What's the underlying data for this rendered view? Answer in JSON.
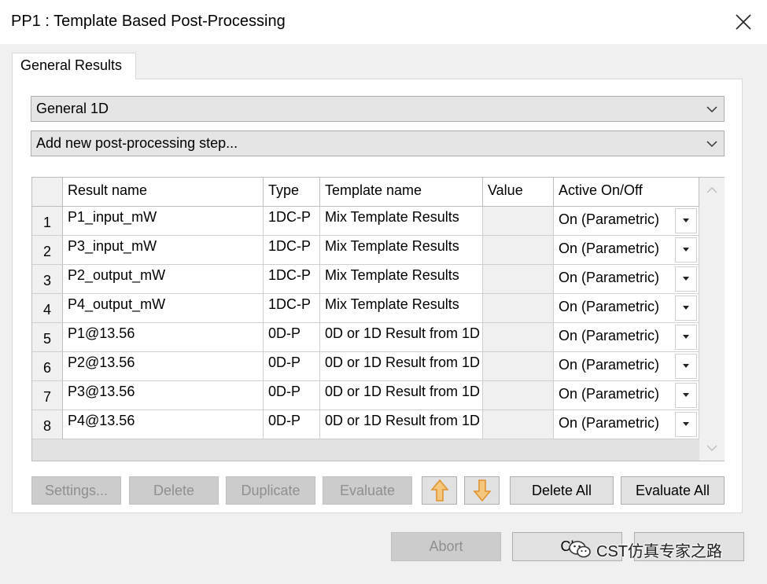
{
  "window": {
    "title": "PP1 : Template Based Post-Processing"
  },
  "tabs": [
    {
      "label": "General Results"
    }
  ],
  "combos": {
    "category": "General 1D",
    "add_step": "Add new post-processing step..."
  },
  "table": {
    "columns": [
      "Result name",
      "Type",
      "Template name",
      "Value",
      "Active On/Off"
    ],
    "rows": [
      {
        "num": "1",
        "name": "P1_input_mW",
        "type": "1DC-P",
        "template": "Mix Template Results",
        "value": "",
        "active": "On (Parametric)"
      },
      {
        "num": "2",
        "name": "P3_input_mW",
        "type": "1DC-P",
        "template": "Mix Template Results",
        "value": "",
        "active": "On (Parametric)"
      },
      {
        "num": "3",
        "name": "P2_output_mW",
        "type": "1DC-P",
        "template": "Mix Template Results",
        "value": "",
        "active": "On (Parametric)"
      },
      {
        "num": "4",
        "name": "P4_output_mW",
        "type": "1DC-P",
        "template": "Mix Template Results",
        "value": "",
        "active": "On (Parametric)"
      },
      {
        "num": "5",
        "name": "P1@13.56",
        "type": "0D-P",
        "template": "0D or 1D Result from 1D",
        "value": "",
        "active": "On (Parametric)"
      },
      {
        "num": "6",
        "name": "P2@13.56",
        "type": "0D-P",
        "template": "0D or 1D Result from 1D",
        "value": "",
        "active": "On (Parametric)"
      },
      {
        "num": "7",
        "name": "P3@13.56",
        "type": "0D-P",
        "template": "0D or 1D Result from 1D",
        "value": "",
        "active": "On (Parametric)"
      },
      {
        "num": "8",
        "name": "P4@13.56",
        "type": "0D-P",
        "template": "0D or 1D Result from 1D",
        "value": "",
        "active": "On (Parametric)"
      }
    ]
  },
  "buttons": {
    "settings": "Settings...",
    "delete": "Delete",
    "duplicate": "Duplicate",
    "evaluate": "Evaluate",
    "delete_all": "Delete All",
    "evaluate_all": "Evaluate All",
    "abort": "Abort",
    "close": "Cl"
  },
  "icons": {
    "move_up": "arrow-up-icon",
    "move_down": "arrow-down-icon",
    "close": "close-icon"
  },
  "colors": {
    "arrow_fill": "#f5c77e",
    "arrow_stroke": "#e0912a"
  },
  "watermark": "CST仿真专家之路"
}
